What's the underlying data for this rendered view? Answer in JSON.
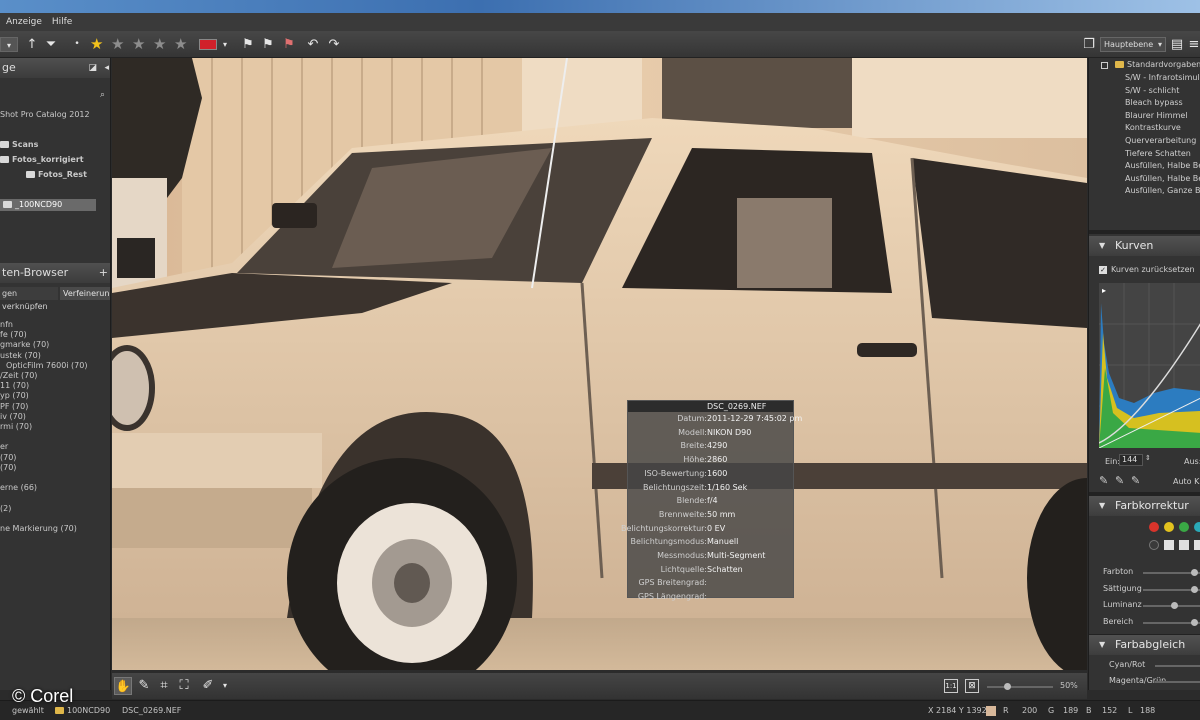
{
  "menu": {
    "items": [
      "Anzeige",
      "Hilfe"
    ]
  },
  "toolbar": {
    "layer_select": "Hauptebene",
    "rating_stars": 5,
    "rating_filled": 1,
    "color_label_hex": "#d0202a"
  },
  "left_panel": {
    "title": "ge",
    "catalog": "Shot Pro Catalog 2012",
    "tree": [
      {
        "label": "Scans",
        "indent": 0
      },
      {
        "label": "Fotos_korrigiert",
        "indent": 0
      },
      {
        "label": "Fotos_Rest",
        "indent": 1
      },
      {
        "label": "_100NCD90",
        "indent": 0,
        "selected": true
      }
    ],
    "browser_title": "ten-Browser",
    "browser_tabs": [
      "gen verknüpfen",
      "Verfeinerung"
    ],
    "keywords": [
      "nfn",
      "fe (70)",
      "gmarke (70)",
      "ustek (70)",
      "OpticFilm 7600i (70)",
      "/Zeit (70)",
      "11 (70)",
      "yp (70)",
      "PF (70)",
      "iv (70)",
      "rmi (70)",
      "",
      "er",
      "(70)",
      "(70)",
      "",
      "erne (66)",
      "",
      "(2)",
      "",
      "ne Markierung (70)"
    ]
  },
  "info_overlay": {
    "filename": "DSC_0269.NEF",
    "rows": [
      {
        "key": "Datum:",
        "value": "2011-12-29 7:45:02 pm"
      },
      {
        "key": "Modell:",
        "value": "NIKON D90"
      },
      {
        "key": "Breite:",
        "value": "4290"
      },
      {
        "key": "Höhe:",
        "value": "2860"
      },
      {
        "key": "ISO-Bewertung:",
        "value": "1600"
      },
      {
        "key": "Belichtungszeit:",
        "value": "1/160 Sek"
      },
      {
        "key": "Blende:",
        "value": "f/4"
      },
      {
        "key": "Brennweite:",
        "value": "50 mm"
      },
      {
        "key": "Belichtungskorrektur:",
        "value": "0 EV"
      },
      {
        "key": "Belichtungsmodus:",
        "value": "Manuell"
      },
      {
        "key": "Messmodus:",
        "value": "Multi-Segment"
      },
      {
        "key": "Lichtquelle:",
        "value": "Schatten"
      },
      {
        "key": "GPS Breitengrad:",
        "value": ""
      },
      {
        "key": "GPS Längengrad:",
        "value": ""
      }
    ]
  },
  "right_panel": {
    "presets_root": "Standardvorgaben",
    "presets": [
      "S/W - Infrarotsimul",
      "S/W - schlicht",
      "Bleach bypass",
      "Blaurer Himmel",
      "Kontrastkurve",
      "Querverarbeitung",
      "Tiefere Schatten",
      "Ausfüllen, Halbe Bel",
      "Ausfüllen, Halbe Bel",
      "Ausfüllen, Ganze Bel"
    ],
    "curves_title": "Kurven",
    "curves_reset": "Kurven zurücksetzen",
    "curves_in_label": "Ein:",
    "curves_in_value": "144",
    "curves_out_label": "Aus:",
    "curves_auto": "Auto K",
    "color_correction_title": "Farbkorrektur",
    "swatches": [
      "#d9342b",
      "#e3c21e",
      "#3aa845",
      "#2aaab8"
    ],
    "swatches_row2": [
      "#3a3a3a",
      "#e0e0e0",
      "#e0e0e0",
      "#e0e0e0"
    ],
    "color_sliders": [
      "Farbton",
      "Sättigung",
      "Luminanz",
      "Bereich"
    ],
    "color_slider_levels": [
      0.95,
      0.95,
      0.55,
      0.95
    ],
    "balance_title": "Farbabgleich",
    "balance_sliders": [
      "Cyan/Rot",
      "Magenta/Grün"
    ]
  },
  "bottom_toolbar": {
    "zoom": "50%",
    "zoom_level": 0.3
  },
  "status_bar": {
    "location": "gewählt",
    "folder": "100NCD90",
    "filename": "DSC_0269.NEF",
    "coords": "X 2184  Y 1392",
    "r_label": "R",
    "r_value": "200",
    "g_label": "G",
    "g_value": "189",
    "b_label": "B",
    "b_value": "152",
    "l_label": "L",
    "l_value": "188",
    "swatch": "#d8b89a"
  },
  "watermark": "© Corel"
}
